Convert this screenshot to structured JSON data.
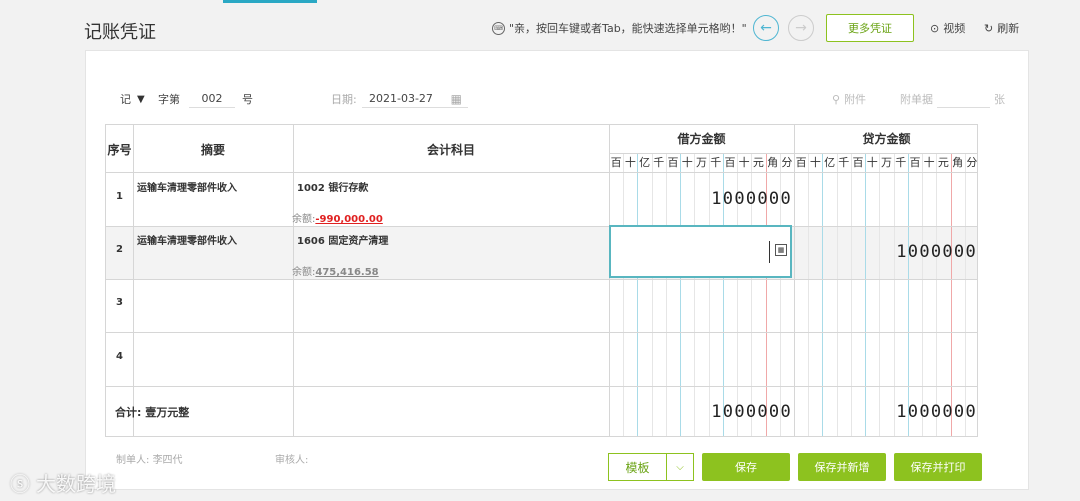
{
  "header": {
    "title": "记账凭证",
    "tip": "\"亲，按回车键或者Tab，能快速选择单元格哟！\"",
    "more_button": "更多凭证",
    "video": "视频",
    "refresh": "刷新"
  },
  "voucher": {
    "type": "记",
    "word_label": "字第",
    "number": "002",
    "hao": "号",
    "date_label": "日期:",
    "date_value": "2021-03-27",
    "attachment": "附件",
    "attach_count_label": "附单据",
    "attach_count": "",
    "zhang": "张"
  },
  "table": {
    "headers": {
      "no": "序号",
      "summary": "摘要",
      "account": "会计科目",
      "debit": "借方金额",
      "credit": "贷方金额"
    },
    "digits": [
      "百",
      "十",
      "亿",
      "千",
      "百",
      "十",
      "万",
      "千",
      "百",
      "十",
      "元",
      "角",
      "分"
    ],
    "rows": [
      {
        "no": "1",
        "summary": "运输车清理零部件收入",
        "account": "1002 银行存款",
        "balance_label": "余额:",
        "balance": "-990,000.00",
        "debit": "1000000",
        "credit": ""
      },
      {
        "no": "2",
        "summary": "运输车清理零部件收入",
        "account": "1606 固定资产清理",
        "balance_label": "余额:",
        "balance": "475,416.58",
        "debit": "",
        "credit": "1000000"
      },
      {
        "no": "3",
        "summary": "",
        "account": "",
        "balance_label": "",
        "balance": "",
        "debit": "",
        "credit": ""
      },
      {
        "no": "4",
        "summary": "",
        "account": "",
        "balance_label": "",
        "balance": "",
        "debit": "",
        "credit": ""
      }
    ],
    "total_label": "合计:",
    "total_words": "壹万元整",
    "total_debit": "1000000",
    "total_credit": "1000000"
  },
  "footer": {
    "maker_label": "制单人:",
    "maker": "李四代",
    "reviewer_label": "审核人:",
    "template": "模板",
    "save": "保存",
    "save_new": "保存并新增",
    "save_print": "保存并打印"
  },
  "watermark": "大数跨境",
  "colors": {
    "accent_green": "#8dc21f",
    "accent_blue": "#2aa8c4",
    "negative": "#e02020"
  }
}
